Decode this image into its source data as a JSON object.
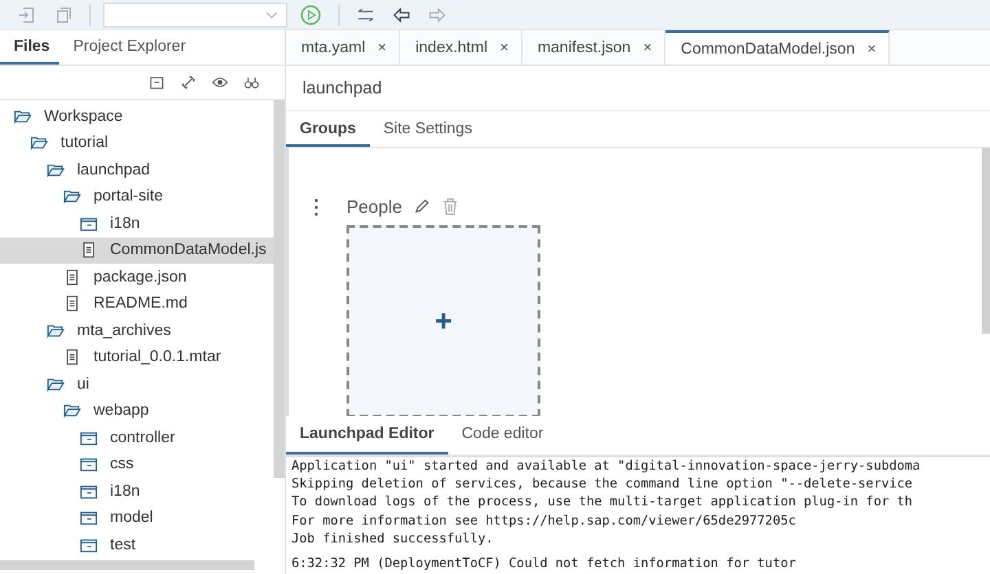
{
  "side_tabs": [
    {
      "label": "Files",
      "selected": true
    },
    {
      "label": "Project Explorer",
      "selected": false
    }
  ],
  "tree": [
    {
      "label": "Workspace",
      "kind": "folder",
      "expanded": true,
      "selected": false,
      "children": [
        {
          "label": "tutorial",
          "kind": "folder",
          "expanded": true,
          "selected": false,
          "children": [
            {
              "label": "launchpad",
              "kind": "folder",
              "expanded": true,
              "selected": false,
              "children": [
                {
                  "label": "portal-site",
                  "kind": "folder",
                  "expanded": true,
                  "selected": false,
                  "children": [
                    {
                      "label": "i18n",
                      "kind": "folder",
                      "expanded": false,
                      "selected": false
                    },
                    {
                      "label": "CommonDataModel.js",
                      "kind": "file",
                      "selected": true
                    }
                  ]
                },
                {
                  "label": "package.json",
                  "kind": "file",
                  "selected": false
                },
                {
                  "label": "README.md",
                  "kind": "file",
                  "selected": false
                }
              ]
            },
            {
              "label": "mta_archives",
              "kind": "folder",
              "expanded": true,
              "selected": false,
              "children": [
                {
                  "label": "tutorial_0.0.1.mtar",
                  "kind": "file",
                  "selected": false
                }
              ]
            },
            {
              "label": "ui",
              "kind": "folder",
              "expanded": true,
              "selected": false,
              "children": [
                {
                  "label": "webapp",
                  "kind": "folder",
                  "expanded": true,
                  "selected": false,
                  "children": [
                    {
                      "label": "controller",
                      "kind": "folder",
                      "expanded": false,
                      "selected": false
                    },
                    {
                      "label": "css",
                      "kind": "folder",
                      "expanded": false,
                      "selected": false
                    },
                    {
                      "label": "i18n",
                      "kind": "folder",
                      "expanded": false,
                      "selected": false
                    },
                    {
                      "label": "model",
                      "kind": "folder",
                      "expanded": false,
                      "selected": false
                    },
                    {
                      "label": "test",
                      "kind": "folder",
                      "expanded": false,
                      "selected": false
                    }
                  ]
                }
              ]
            }
          ]
        }
      ]
    }
  ],
  "editor_tabs": [
    {
      "label": "mta.yaml",
      "close": "×",
      "selected": false
    },
    {
      "label": "index.html",
      "close": "×",
      "selected": false
    },
    {
      "label": "manifest.json",
      "close": "×",
      "selected": false
    },
    {
      "label": "CommonDataModel.json",
      "close": "×",
      "selected": true
    }
  ],
  "page_title": "launchpad",
  "inner_tabs": [
    {
      "label": "Groups",
      "selected": true
    },
    {
      "label": "Site Settings",
      "selected": false
    }
  ],
  "group": {
    "name": "People",
    "add": "+"
  },
  "bottom_tabs": [
    {
      "label": "Launchpad Editor",
      "selected": true
    },
    {
      "label": "Code editor",
      "selected": false
    }
  ],
  "console": [
    "Application \"ui\" started and available at \"digital-innovation-space-jerry-subdoma",
    "Skipping deletion of services, because the command line option \"--delete-service",
    "To download logs of the process, use the multi-target application plug-in for th",
    "For more information see https://help.sap.com/viewer/65de2977205c",
    "Job finished successfully.",
    "6:32:32 PM (DeploymentToCF) Could not fetch information for tutor"
  ]
}
